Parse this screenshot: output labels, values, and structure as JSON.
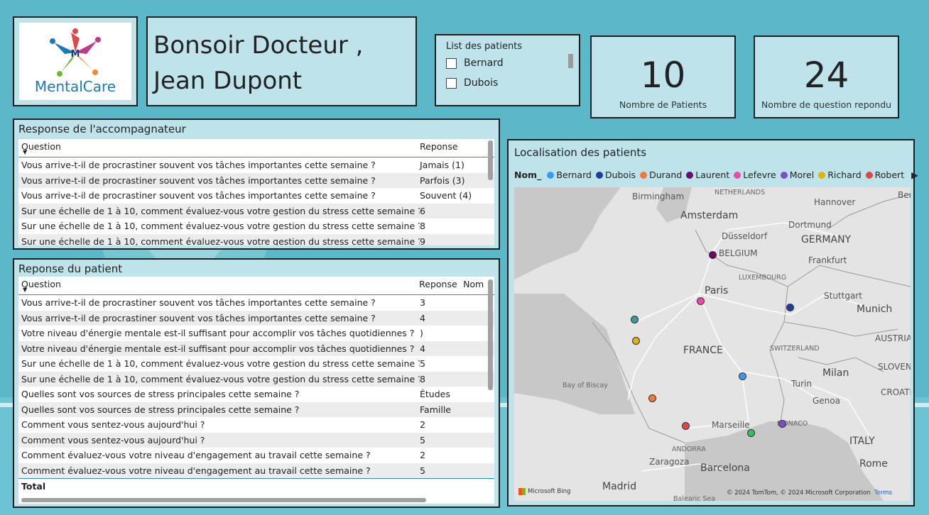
{
  "logo": {
    "text": "MentalCare"
  },
  "greeting": {
    "line1": "Bonsoir Docteur ,",
    "line2": "Jean Dupont"
  },
  "slicer": {
    "title": "List des patients",
    "items": [
      "Bernard",
      "Dubois"
    ]
  },
  "kpis": [
    {
      "value": "10",
      "label": "Nombre de Patients"
    },
    {
      "value": "24",
      "label": "Nombre de question repondu"
    }
  ],
  "companion_table": {
    "title": "Response de l'accompagnateur",
    "headers": {
      "question": "Question",
      "answer": "Reponse"
    },
    "rows": [
      {
        "q": "Vous arrive-t-il de procrastiner souvent vos tâches importantes cette semaine ?",
        "a": "Jamais (1)"
      },
      {
        "q": "Vous arrive-t-il de procrastiner souvent vos tâches importantes cette semaine ?",
        "a": "Parfois (3)"
      },
      {
        "q": "Vous arrive-t-il de procrastiner souvent vos tâches importantes cette semaine ?",
        "a": "Souvent (4)"
      },
      {
        "q": "Sur une échelle de 1 à 10, comment évaluez-vous votre gestion du stress cette semaine ?",
        "a": "6"
      },
      {
        "q": "Sur une échelle de 1 à 10, comment évaluez-vous votre gestion du stress cette semaine ?",
        "a": "8"
      },
      {
        "q": "Sur une échelle de 1 à 10, comment évaluez-vous votre gestion du stress cette semaine ?",
        "a": "9"
      }
    ]
  },
  "patient_table": {
    "title": "Reponse du patient",
    "headers": {
      "question": "Question",
      "answer": "Reponse",
      "name": "Nom"
    },
    "rows": [
      {
        "q": "Vous arrive-t-il de procrastiner souvent vos tâches importantes cette semaine ?",
        "a": "3"
      },
      {
        "q": "Vous arrive-t-il de procrastiner souvent vos tâches importantes cette semaine ?",
        "a": "4"
      },
      {
        "q": "Votre niveau d'énergie mentale est-il suffisant pour accomplir vos tâches quotidiennes ?",
        "a": ")"
      },
      {
        "q": "Votre niveau d'énergie mentale est-il suffisant pour accomplir vos tâches quotidiennes ?",
        "a": "4"
      },
      {
        "q": "Sur une échelle de 1 à 10, comment évaluez-vous votre gestion du stress cette semaine ?",
        "a": "5"
      },
      {
        "q": "Sur une échelle de 1 à 10, comment évaluez-vous votre gestion du stress cette semaine ?",
        "a": "8"
      },
      {
        "q": "Quelles sont vos sources de stress principales cette semaine ?",
        "a": "Études"
      },
      {
        "q": "Quelles sont vos sources de stress principales cette semaine ?",
        "a": "Famille"
      },
      {
        "q": "Comment vous sentez-vous aujourd'hui ?",
        "a": "2"
      },
      {
        "q": "Comment vous sentez-vous aujourd'hui ?",
        "a": "5"
      },
      {
        "q": "Comment évaluez-vous votre niveau d'engagement au travail cette semaine ?",
        "a": "2"
      },
      {
        "q": "Comment évaluez-vous votre niveau d'engagement au travail cette semaine ?",
        "a": "5"
      }
    ],
    "total_label": "Total"
  },
  "map": {
    "title": "Localisation des patients",
    "legend_label": "Nom_",
    "legend": [
      {
        "name": "Bernard",
        "color": "#3a9af0"
      },
      {
        "name": "Dubois",
        "color": "#1f3d9c"
      },
      {
        "name": "Durand",
        "color": "#f07a3a"
      },
      {
        "name": "Laurent",
        "color": "#6a0a6a"
      },
      {
        "name": "Lefevre",
        "color": "#e84ca8"
      },
      {
        "name": "Morel",
        "color": "#7b4fc4"
      },
      {
        "name": "Richard",
        "color": "#e0b400"
      },
      {
        "name": "Robert",
        "color": "#e04848"
      }
    ],
    "labels": [
      "Birmingham",
      "NETHERLANDS",
      "Berlin",
      "Hannover",
      "Amsterdam",
      "Düsseldorf",
      "Dortmund",
      "GERMANY",
      "BELGIUM",
      "Frankfurt",
      "LUXEMBOURG",
      "Paris",
      "Stuttgart",
      "Munich",
      "FRANCE",
      "AUSTRIA",
      "SWITZERLAND",
      "SLOVENIA",
      "Milan",
      "Bay of Biscay",
      "Turin",
      "CROATIA",
      "Genoa",
      "Marseille",
      "MONACO",
      "ITALY",
      "ANDORRA",
      "Zaragoza",
      "Barcelona",
      "Rome",
      "Madrid",
      "Balearic Sea"
    ],
    "attribution": "© 2024 TomTom, © 2024 Microsoft Corporation",
    "terms": "Terms",
    "bing": "Microsoft Bing"
  }
}
